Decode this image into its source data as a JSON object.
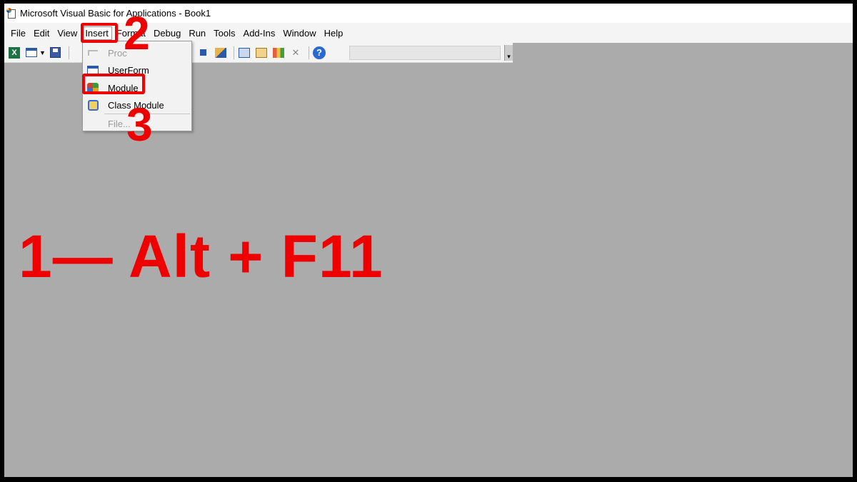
{
  "window": {
    "title": "Microsoft Visual Basic for Applications - Book1"
  },
  "menubar": {
    "items": [
      "File",
      "Edit",
      "View",
      "Insert",
      "Format",
      "Debug",
      "Run",
      "Tools",
      "Add-Ins",
      "Window",
      "Help"
    ],
    "active": "Insert"
  },
  "toolbar": {
    "icons": [
      "view-excel-icon",
      "insert-userform-icon",
      "dropdown-caret-icon",
      "save-icon",
      "cut-icon",
      "break-icon",
      "reset-icon",
      "design-mode-icon",
      "project-explorer-icon",
      "properties-icon",
      "object-browser-icon",
      "toolbox-icon",
      "help-icon"
    ]
  },
  "insert_menu": {
    "items": [
      {
        "label": "Procedure...",
        "shown": "Proc",
        "enabled": false,
        "icon": "procedure-icon"
      },
      {
        "label": "UserForm",
        "enabled": true,
        "icon": "userform-icon"
      },
      {
        "label": "Module",
        "enabled": true,
        "icon": "module-icon"
      },
      {
        "label": "Class Module",
        "enabled": true,
        "icon": "class-module-icon"
      },
      {
        "label": "File...",
        "enabled": false,
        "icon": ""
      }
    ]
  },
  "annotations": {
    "step1": "1— Alt + F11",
    "step2": "2",
    "step3": "3",
    "color": "#ef0000"
  }
}
